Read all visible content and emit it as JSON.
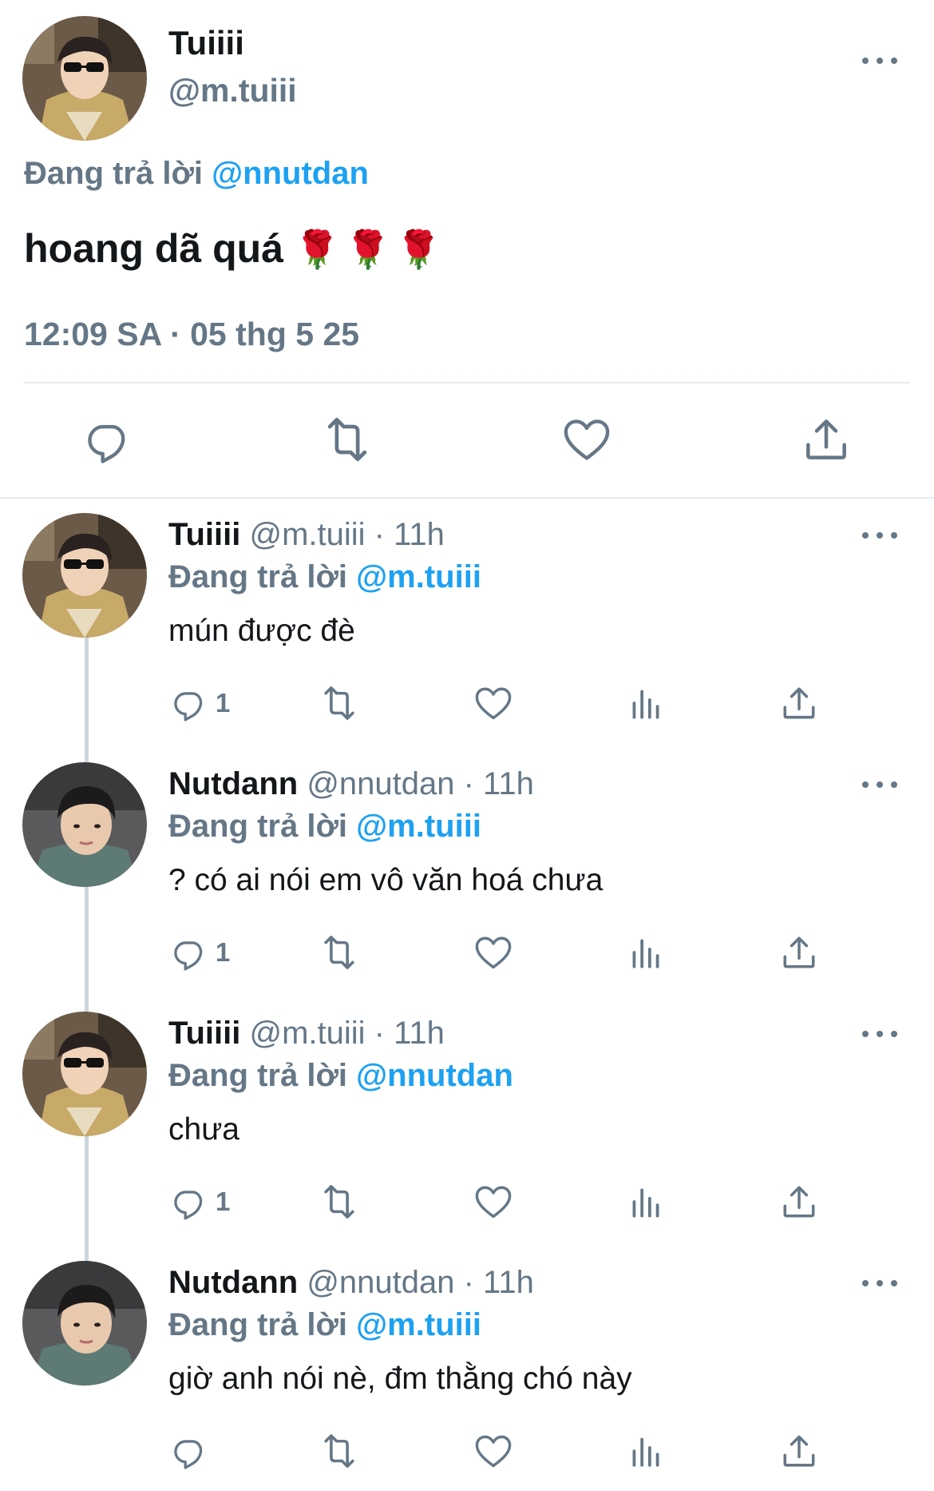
{
  "main_tweet": {
    "display_name": "Tuiiii",
    "handle": "@m.tuiii",
    "reply_prefix": "Đang trả lời",
    "reply_to": "@nnutdan",
    "text": "hoang dã quá",
    "emoji": "🌹🌹🌹",
    "timestamp": "12:09 SA · 05 thg 5 25"
  },
  "replies": [
    {
      "display_name": "Tuiiii",
      "handle_time": "@m.tuiii · 11h",
      "reply_prefix": "Đang trả lời",
      "reply_to": "@m.tuiii",
      "text": "mún được đè",
      "reply_count": "1",
      "avatar": "tuiiii"
    },
    {
      "display_name": "Nutdann",
      "handle_time": "@nnutdan · 11h",
      "reply_prefix": "Đang trả lời",
      "reply_to": "@m.tuiii",
      "text": "? có ai nói em vô văn hoá chưa",
      "reply_count": "1",
      "avatar": "nutdann"
    },
    {
      "display_name": "Tuiiii",
      "handle_time": "@m.tuiii · 11h",
      "reply_prefix": "Đang trả lời",
      "reply_to": "@nnutdan",
      "text": "chưa",
      "reply_count": "1",
      "avatar": "tuiiii"
    },
    {
      "display_name": "Nutdann",
      "handle_time": "@nnutdan · 11h",
      "reply_prefix": "Đang trả lời",
      "reply_to": "@m.tuiii",
      "text": "giờ anh nói nè, đm thằng chó này",
      "reply_count": "",
      "avatar": "nutdann"
    }
  ],
  "icons": {
    "reply": "comment-bubble-icon",
    "retweet": "retweet-icon",
    "like": "heart-icon",
    "share": "share-upload-icon",
    "views": "bar-chart-icon",
    "more": "more-dots-icon"
  },
  "colors": {
    "link_blue": "#1da1f2",
    "meta_gray": "#657786",
    "divider": "#e6ecf0",
    "thread_line": "#ccd6dd"
  }
}
